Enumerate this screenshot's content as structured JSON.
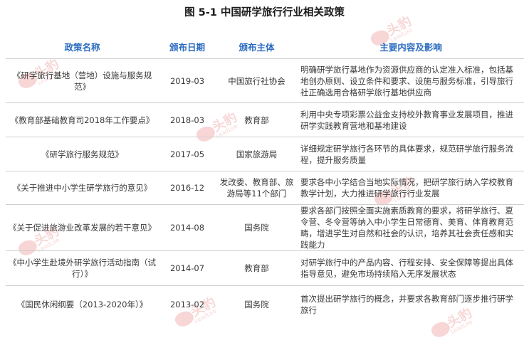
{
  "title": "图  5-1 中国研学旅行行业相关政策",
  "headers": [
    "政策名称",
    "颁布日期",
    "颁布主体",
    "主要内容及影响"
  ],
  "rows": [
    {
      "name": "《研学旅行基地（营地）设施与服务规范》",
      "date": "2019-03",
      "issuer": "中国旅行社协会",
      "content": "明确研学旅行基地作为资源供应商的认定准入标准，包括基地创办原则、设立条件和要求、设施与服务标准，引导旅行社正确选用合格研学旅行基地供应商"
    },
    {
      "name": "《教育部基础教育司2018年工作要点》",
      "date": "2018-03",
      "issuer": "教育部",
      "content": "利用中央专项彩票公益金支持校外教育事业发展项目，推进研学实践教育营地和基地建设"
    },
    {
      "name": "《研学旅行服务规范》",
      "date": "2017-05",
      "issuer": "国家旅游局",
      "content": "详细规定研学旅行各环节的具体要求，规范研学旅行服务流程，提升服务质量"
    },
    {
      "name": "《关于推进中小学生研学旅行的意见》",
      "date": "2016-12",
      "issuer": "发改委、教育部、旅游局等11个部门",
      "content": "要求各中小学结合当地实际情况，把研学旅行纳入学校教育教学计划，大力推进研学旅行行业发展"
    },
    {
      "name": "《关于促进旅游业改革发展的若干意见》",
      "date": "2014-08",
      "issuer": "国务院",
      "content": "要求各部门按照全面实施素质教育的要求，将研学旅行、夏令营、冬令营等纳入中小学生日常德育、美育、体育教育范畴，增进学生对自然和社会的认识，培养其社会责任感和实践能力"
    },
    {
      "name": "《中小学生赴境外研学旅行活动指南（试行）》",
      "date": "2014-07",
      "issuer": "教育部",
      "content": "对研学旅行中的产品内容、行程安排、安全保障等提出具体指导意见，避免市场持续陷入无序发展状态"
    },
    {
      "name": "《国民休闲纲要（2013-2020年）》",
      "date": "2013-02",
      "issuer": "国务院",
      "content": "首次提出研学旅行的概念，并要求各教育部门逐步推行研学旅行"
    }
  ],
  "watermark": {
    "text": "头豹",
    "sub": "LeadLeo"
  },
  "colors": {
    "header": "#2a6bc0",
    "watermark": "#e24a4a",
    "rule": "#cfcfcf"
  }
}
